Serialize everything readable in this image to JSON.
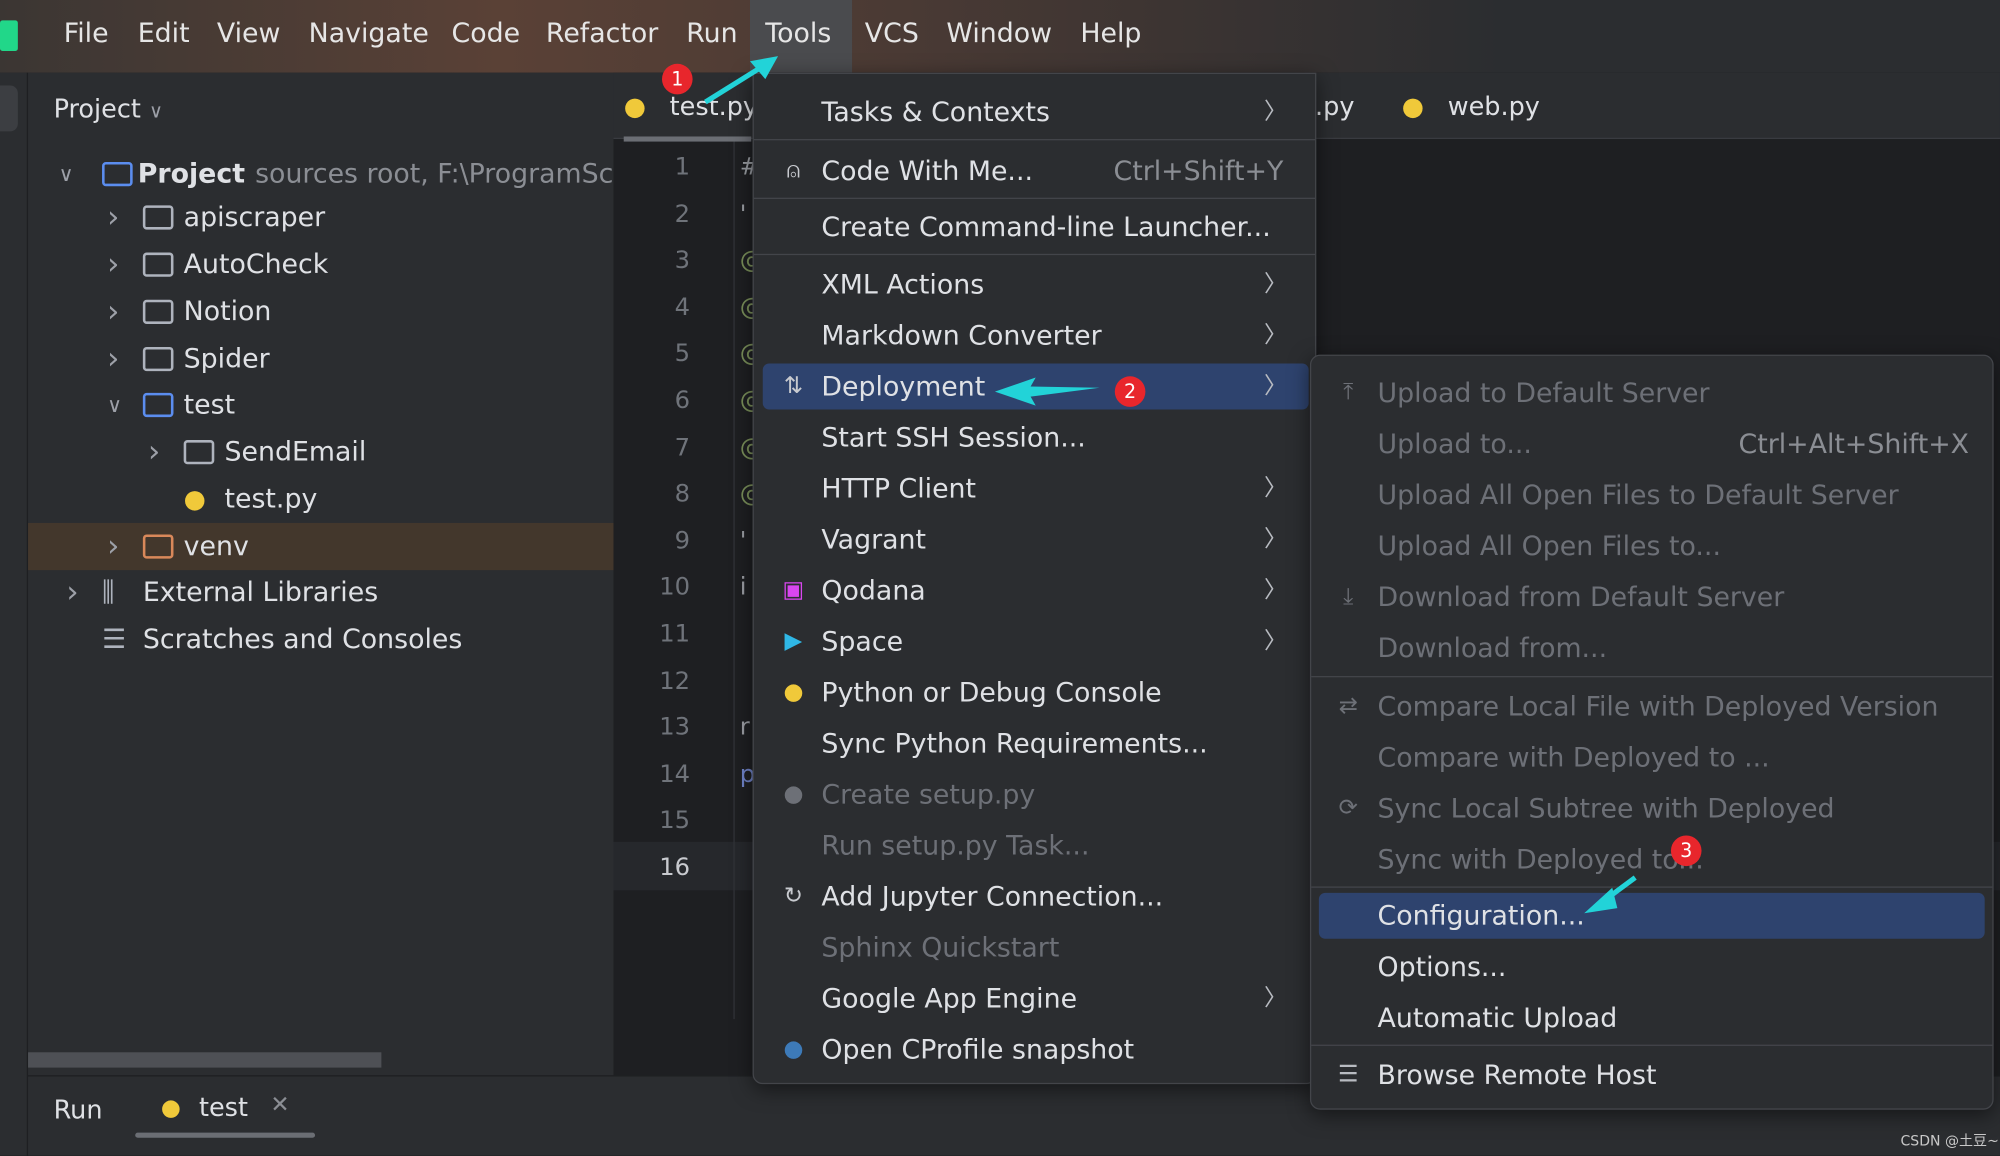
{
  "menubar": {
    "items": [
      "File",
      "Edit",
      "View",
      "Navigate",
      "Code",
      "Refactor",
      "Run",
      "Tools",
      "VCS",
      "Window",
      "Help"
    ],
    "active": "Tools"
  },
  "project": {
    "title": "Project",
    "root": {
      "label": "Project",
      "hint": "sources root,  F:\\ProgramSc"
    },
    "items": [
      {
        "label": "apiscraper",
        "type": "folder",
        "depth": 1,
        "expanded": false
      },
      {
        "label": "AutoCheck",
        "type": "folder",
        "depth": 1,
        "expanded": false
      },
      {
        "label": "Notion",
        "type": "folder",
        "depth": 1,
        "expanded": false
      },
      {
        "label": "Spider",
        "type": "folder",
        "depth": 1,
        "expanded": false
      },
      {
        "label": "test",
        "type": "folder-blue",
        "depth": 1,
        "expanded": true
      },
      {
        "label": "SendEmail",
        "type": "folder",
        "depth": 2,
        "expanded": false
      },
      {
        "label": "test.py",
        "type": "python-file",
        "depth": 2
      },
      {
        "label": "venv",
        "type": "folder-orange",
        "depth": 1,
        "expanded": false,
        "selected": true
      },
      {
        "label": "External Libraries",
        "type": "library",
        "depth": 0,
        "expanded": false
      },
      {
        "label": "Scratches and Consoles",
        "type": "scratches",
        "depth": 0
      }
    ]
  },
  "editor": {
    "tabs": [
      {
        "label": "test.py",
        "active": true
      },
      {
        "label": ".py"
      },
      {
        "label": "web.py"
      }
    ],
    "lines": [
      "#",
      "'",
      "@",
      "@",
      "@",
      "@",
      "@",
      "@",
      "'",
      "i",
      "",
      "",
      "r",
      "p",
      "",
      ""
    ],
    "current_line": 16
  },
  "tools_menu": [
    {
      "label": "Tasks & Contexts",
      "submenu": true,
      "sep_after": true
    },
    {
      "label": "Code With Me...",
      "shortcut": "Ctrl+Shift+Y",
      "icon": "user-add-icon",
      "sep_after": true
    },
    {
      "label": "Create Command-line Launcher...",
      "sep_after": true
    },
    {
      "label": "XML Actions",
      "submenu": true
    },
    {
      "label": "Markdown Converter",
      "submenu": true
    },
    {
      "label": "Deployment",
      "submenu": true,
      "icon": "deployment-icon",
      "highlighted": true
    },
    {
      "label": "Start SSH Session..."
    },
    {
      "label": "HTTP Client",
      "submenu": true
    },
    {
      "label": "Vagrant",
      "submenu": true
    },
    {
      "label": "Qodana",
      "submenu": true,
      "icon": "qodana-icon"
    },
    {
      "label": "Space",
      "submenu": true,
      "icon": "space-icon"
    },
    {
      "label": "Python or Debug Console",
      "icon": "python-console-icon"
    },
    {
      "label": "Sync Python Requirements..."
    },
    {
      "label": "Create setup.py",
      "disabled": true,
      "icon": "python-icon"
    },
    {
      "label": "Run setup.py Task...",
      "disabled": true
    },
    {
      "label": "Add Jupyter Connection...",
      "icon": "jupyter-icon"
    },
    {
      "label": "Sphinx Quickstart",
      "disabled": true
    },
    {
      "label": "Google App Engine",
      "submenu": true
    },
    {
      "label": "Open CProfile snapshot",
      "icon": "cprofile-icon"
    }
  ],
  "deployment_menu": [
    {
      "label": "Upload to Default Server",
      "disabled": true,
      "icon": "upload-icon"
    },
    {
      "label": "Upload to...",
      "disabled": true,
      "shortcut": "Ctrl+Alt+Shift+X"
    },
    {
      "label": "Upload All Open Files to Default Server",
      "disabled": true
    },
    {
      "label": "Upload All Open Files to...",
      "disabled": true
    },
    {
      "label": "Download from Default Server",
      "disabled": true,
      "icon": "download-icon"
    },
    {
      "label": "Download from...",
      "disabled": true,
      "sep_after": true
    },
    {
      "label": "Compare Local File with Deployed Version",
      "disabled": true,
      "icon": "compare-icon"
    },
    {
      "label": "Compare with Deployed to ...",
      "disabled": true
    },
    {
      "label": "Sync Local Subtree with Deployed",
      "disabled": true,
      "icon": "sync-icon"
    },
    {
      "label": "Sync with Deployed to...",
      "disabled": true,
      "sep_after": true
    },
    {
      "label": "Configuration...",
      "highlighted": true
    },
    {
      "label": "Options..."
    },
    {
      "label": "Automatic Upload",
      "sep_after": true
    },
    {
      "label": "Browse Remote Host",
      "icon": "server-icon"
    }
  ],
  "bottom": {
    "run_label": "Run",
    "tab_label": "test"
  },
  "annotations": {
    "badges": [
      "1",
      "2",
      "3"
    ],
    "arrow_color": "#22d3d8",
    "badge_color": "#e8262c"
  },
  "watermark": "CSDN @土豆~",
  "colors": {
    "selection": "#2e436e",
    "panel": "#2b2d30",
    "editor": "#1e1f22"
  }
}
